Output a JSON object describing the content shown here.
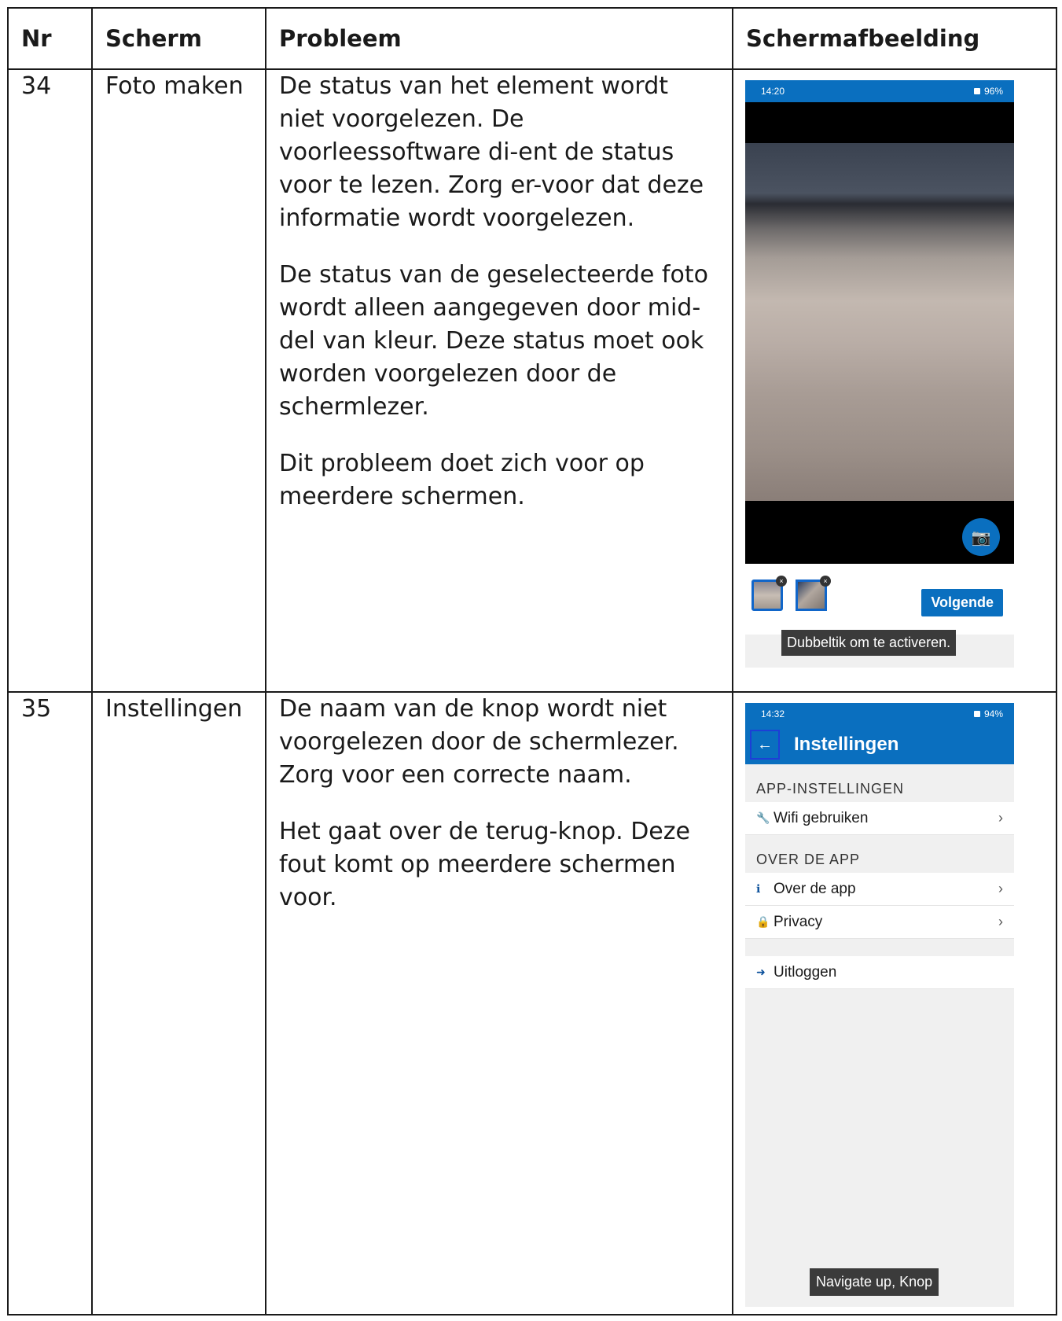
{
  "table": {
    "headers": [
      "Nr",
      "Scherm",
      "Probleem",
      "Schermafbeelding"
    ],
    "rows": [
      {
        "nr": "34",
        "scherm": "Foto maken",
        "paragraphs": [
          "De status van het element wordt niet voorgelezen. De voorleessoftware di-ent de status voor te lezen. Zorg er-voor dat deze informatie wordt voorgelezen.",
          "De status van de geselecteerde foto wordt alleen aangegeven door mid-del van kleur. Deze status moet ook worden voorgelezen door de schermlezer.",
          "Dit probleem doet zich voor op meerdere schermen."
        ],
        "screenshot": {
          "status_time": "14:20",
          "status_battery": "96%",
          "next_button": "Volgende",
          "toast": "Dubbeltik om te activeren."
        }
      },
      {
        "nr": "35",
        "scherm": "Instellingen",
        "paragraphs": [
          "De naam van de knop wordt niet voorgelezen door de schermlezer. Zorg voor een correcte naam.",
          "Het gaat over de terug-knop. Deze fout komt op meerdere schermen voor."
        ],
        "screenshot": {
          "status_time": "14:32",
          "status_battery": "94%",
          "title": "Instellingen",
          "section_app": "APP-INSTELLINGEN",
          "item_wifi": "Wifi gebruiken",
          "section_over": "OVER DE APP",
          "item_over": "Over de app",
          "item_privacy": "Privacy",
          "item_logout": "Uitloggen",
          "toast": "Navigate up, Knop"
        }
      }
    ]
  },
  "colors": {
    "accent": "#0a6fbf",
    "border": "#1a1a1a",
    "toast_bg": "#3b3b3b"
  },
  "icons": [
    "back-arrow-icon",
    "camera-add-icon",
    "wrench-icon",
    "info-icon",
    "lock-icon",
    "logout-icon",
    "chevron-right-icon",
    "close-icon"
  ]
}
